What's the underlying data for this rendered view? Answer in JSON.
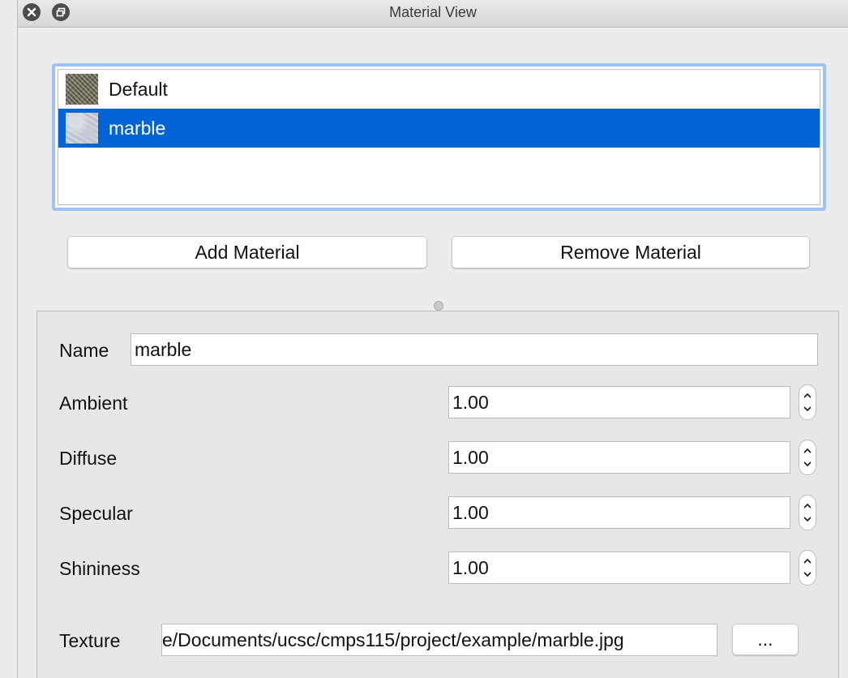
{
  "window": {
    "title": "Material View"
  },
  "materials": [
    {
      "label": "Default",
      "thumb_icon": "texture-thumbnail-icon"
    },
    {
      "label": "marble",
      "thumb_icon": "texture-thumbnail-icon"
    }
  ],
  "selected_material": "marble",
  "buttons": {
    "add": "Add Material",
    "remove": "Remove Material",
    "browse": "..."
  },
  "properties": {
    "name_label": "Name",
    "name_value": "marble",
    "ambient_label": "Ambient",
    "ambient_value": "1.00",
    "diffuse_label": "Diffuse",
    "diffuse_value": "1.00",
    "specular_label": "Specular",
    "specular_value": "1.00",
    "shininess_label": "Shininess",
    "shininess_value": "1.00",
    "texture_label": "Texture",
    "texture_value": "e/Documents/ucsc/cmps115/project/example/marble.jpg"
  },
  "colors": {
    "selection": "#0064d6",
    "focus_ring": "#9cc3f2"
  }
}
